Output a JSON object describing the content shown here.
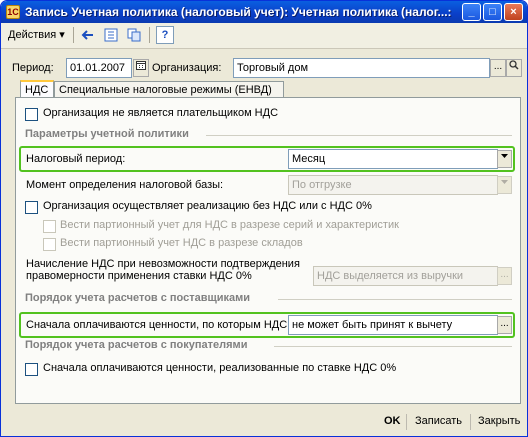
{
  "window": {
    "title": "Запись Учетная политика (налоговый учет): Учетная политика (налог...:",
    "title_icon": "1C",
    "minimize": "_",
    "maximize": "□",
    "close": "×"
  },
  "toolbar": {
    "actions_label": "Действия",
    "actions_arrow": "▾",
    "help_label": "?"
  },
  "header": {
    "period_label": "Период:",
    "period_value": "01.01.2007",
    "org_label": "Организация:",
    "org_value": "Торговый дом",
    "ellipsis": "...",
    "search": "⌕"
  },
  "tabs": [
    {
      "label": "НДС"
    },
    {
      "label": "Специальные налоговые режимы (ЕНВД)"
    }
  ],
  "vat": {
    "not_payer_label": "Организация не является плательщиком НДС",
    "policy_section": "Параметры учетной политики",
    "tax_period_label": "Налоговый период:",
    "tax_period_value": "Месяц",
    "tax_base_label": "Момент определения налоговой базы:",
    "tax_base_value": "По отгрузке",
    "zero_rate_label": "Организация осуществляет реализацию без НДС или с НДС 0%",
    "batch_series_label": "Вести партионный учет для НДС в разрезе серий и характеристик",
    "batch_warehouse_label": "Вести партионный учет НДС в разрезе складов",
    "accrual_label_line1": "Начисление НДС при невозможности подтверждения",
    "accrual_label_line2": "правомерности применения ставки НДС 0%",
    "accrual_value": "НДС выделяется из выручки",
    "suppliers_section": "Порядок учета расчетов с поставщиками",
    "suppliers_label": "Сначала оплачиваются ценности, по которым НДС:",
    "suppliers_value": "не может быть принят к вычету",
    "customers_section": "Порядок учета расчетов с покупателями",
    "customers_label": "Сначала оплачиваются ценности, реализованные по ставке НДС 0%"
  },
  "footer": {
    "ok_label": "OK",
    "save_label": "Записать",
    "close_label": "Закрыть"
  },
  "colors": {
    "highlight": "#52c21f",
    "titlebar": "#0a3ec8"
  }
}
